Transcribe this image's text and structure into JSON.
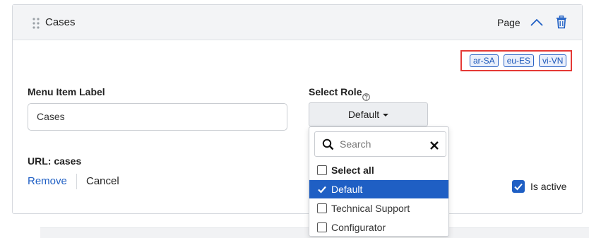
{
  "panel": {
    "title": "Cases",
    "page_text": "Page",
    "locales": [
      "ar-SA",
      "eu-ES",
      "vi-VN"
    ]
  },
  "form": {
    "menu_item_label": "Menu Item Label",
    "menu_item_value": "Cases",
    "select_role_label": "Select Role",
    "role_button_label": "Default",
    "url_text": "URL: cases",
    "remove_label": "Remove",
    "cancel_label": "Cancel",
    "is_active_label": "Is active",
    "is_active_checked": true
  },
  "role_dropdown": {
    "search_placeholder": "Search",
    "select_all_label": "Select all",
    "options": [
      {
        "label": "Default",
        "checked": true
      },
      {
        "label": "Technical Support",
        "checked": false
      },
      {
        "label": "Configurator",
        "checked": false
      }
    ]
  },
  "colors": {
    "accent": "#1f5fc4",
    "highlight_border": "#e53935"
  }
}
